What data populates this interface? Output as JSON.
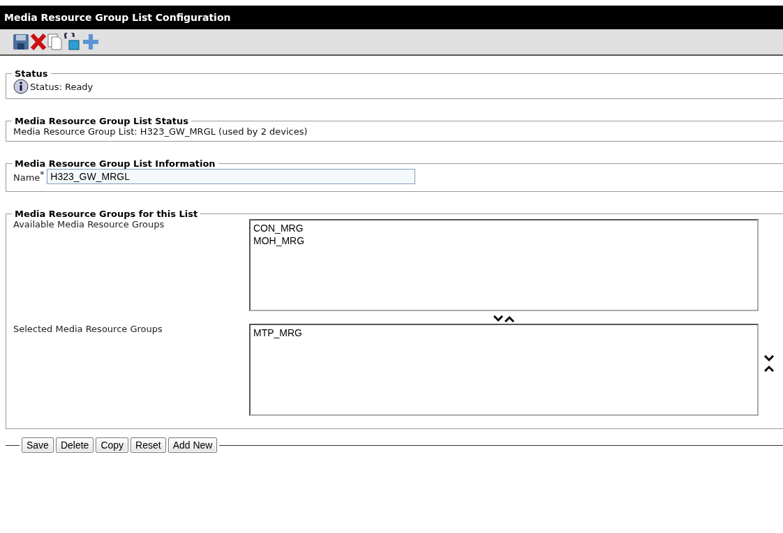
{
  "window": {
    "title": "Media Resource Group List Configuration"
  },
  "status": {
    "legend": "Status",
    "text": "Status: Ready"
  },
  "list_status": {
    "legend": "Media Resource Group List Status",
    "text": "Media Resource Group List: H323_GW_MRGL (used by 2 devices)"
  },
  "information": {
    "legend": "Media Resource Group List Information",
    "name_label": "Name",
    "required_mark": "*",
    "name_value": "H323_GW_MRGL"
  },
  "groups": {
    "legend": "Media Resource Groups for this List",
    "available": {
      "label": "Available Media Resource Groups",
      "items": [
        "CON_MRG",
        "MOH_MRG"
      ]
    },
    "selected": {
      "label": "Selected Media Resource Groups",
      "items": [
        "MTP_MRG"
      ]
    }
  },
  "buttons": [
    "Save",
    "Delete",
    "Copy",
    "Reset",
    "Add New"
  ]
}
